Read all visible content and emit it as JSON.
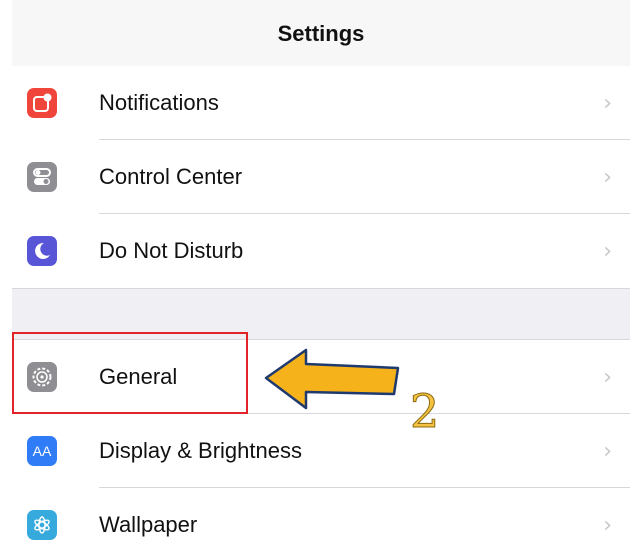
{
  "navbar": {
    "title": "Settings"
  },
  "groups": [
    {
      "items": [
        {
          "label": "Notifications",
          "icon": "notifications-icon",
          "icon_color": "#f0453a"
        },
        {
          "label": "Control Center",
          "icon": "control-center-icon",
          "icon_color": "#8e8e93"
        },
        {
          "label": "Do Not Disturb",
          "icon": "moon-icon",
          "icon_color": "#5856d6"
        }
      ]
    },
    {
      "items": [
        {
          "label": "General",
          "icon": "gear-icon",
          "icon_color": "#8e8e93"
        },
        {
          "label": "Display & Brightness",
          "icon": "display-brightness-icon",
          "icon_color": "#2f7cf6",
          "icon_text": "AA"
        },
        {
          "label": "Wallpaper",
          "icon": "wallpaper-icon",
          "icon_color": "#36aadc"
        }
      ]
    }
  ],
  "chevron": "›",
  "annotation": {
    "step_number": "2",
    "highlight_color": "#e0242a",
    "arrow_color": "#f5b21b"
  }
}
